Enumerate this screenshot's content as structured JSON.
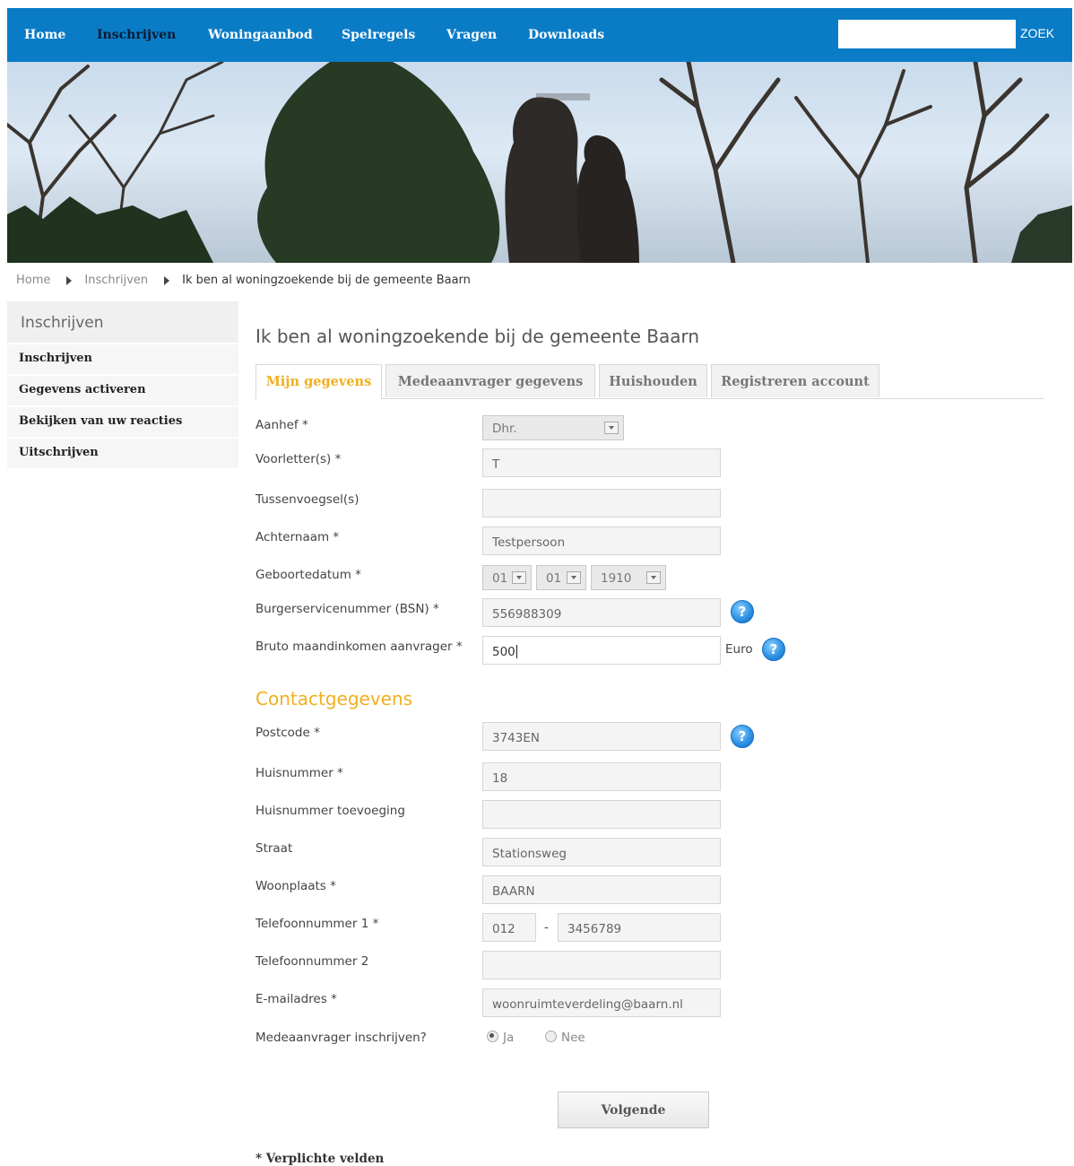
{
  "nav": {
    "items": [
      "Home",
      "Inschrijven",
      "Woningaanbod",
      "Spelregels",
      "Vragen",
      "Downloads"
    ],
    "active": "Inschrijven",
    "search_button": "ZOEK",
    "search_value": ""
  },
  "breadcrumb": [
    "Home",
    "Inschrijven",
    "Ik ben al woningzoekende bij de gemeente Baarn"
  ],
  "sidebar": {
    "title": "Inschrijven",
    "items": [
      "Inschrijven",
      "Gegevens activeren",
      "Bekijken van uw reacties",
      "Uitschrijven"
    ]
  },
  "main": {
    "title": "Ik ben al woningzoekende bij de gemeente Baarn",
    "tabs": [
      "Mijn gegevens",
      "Medeaanvrager gegevens",
      "Huishouden",
      "Registreren account"
    ],
    "active_tab": "Mijn gegevens"
  },
  "form": {
    "aanhef": {
      "label": "Aanhef *",
      "value": "Dhr."
    },
    "voorletters": {
      "label": "Voorletter(s) *",
      "value": "T"
    },
    "tussenvoegsel": {
      "label": "Tussenvoegsel(s)",
      "value": ""
    },
    "achternaam": {
      "label": "Achternaam *",
      "value": "Testpersoon"
    },
    "geboortedatum": {
      "label": "Geboortedatum *",
      "day": "01",
      "month": "01",
      "year": "1910"
    },
    "bsn": {
      "label": "Burgerservicenummer (BSN) *",
      "value": "556988309"
    },
    "inkomen": {
      "label": "Bruto maandinkomen aanvrager *",
      "value": "500",
      "unit": "Euro"
    }
  },
  "contact": {
    "title": "Contactgegevens",
    "postcode": {
      "label": "Postcode *",
      "value": "3743EN"
    },
    "huisnummer": {
      "label": "Huisnummer *",
      "value": "18"
    },
    "toevoeging": {
      "label": "Huisnummer toevoeging",
      "value": ""
    },
    "straat": {
      "label": "Straat",
      "value": "Stationsweg"
    },
    "woonplaats": {
      "label": "Woonplaats *",
      "value": "BAARN"
    },
    "telefoon1": {
      "label": "Telefoonnummer 1 *",
      "prefix": "012",
      "separator": "-",
      "number": "3456789"
    },
    "telefoon2": {
      "label": "Telefoonnummer 2",
      "value": ""
    },
    "email": {
      "label": "E-mailadres *",
      "value": "woonruimteverdeling@baarn.nl"
    },
    "medeaanvrager": {
      "label": "Medeaanvrager inschrijven?",
      "options": [
        "Ja",
        "Nee"
      ],
      "selected": "Ja"
    }
  },
  "help_icon_text": "?",
  "next_button": "Volgende",
  "footnote": "* Verplichte velden"
}
